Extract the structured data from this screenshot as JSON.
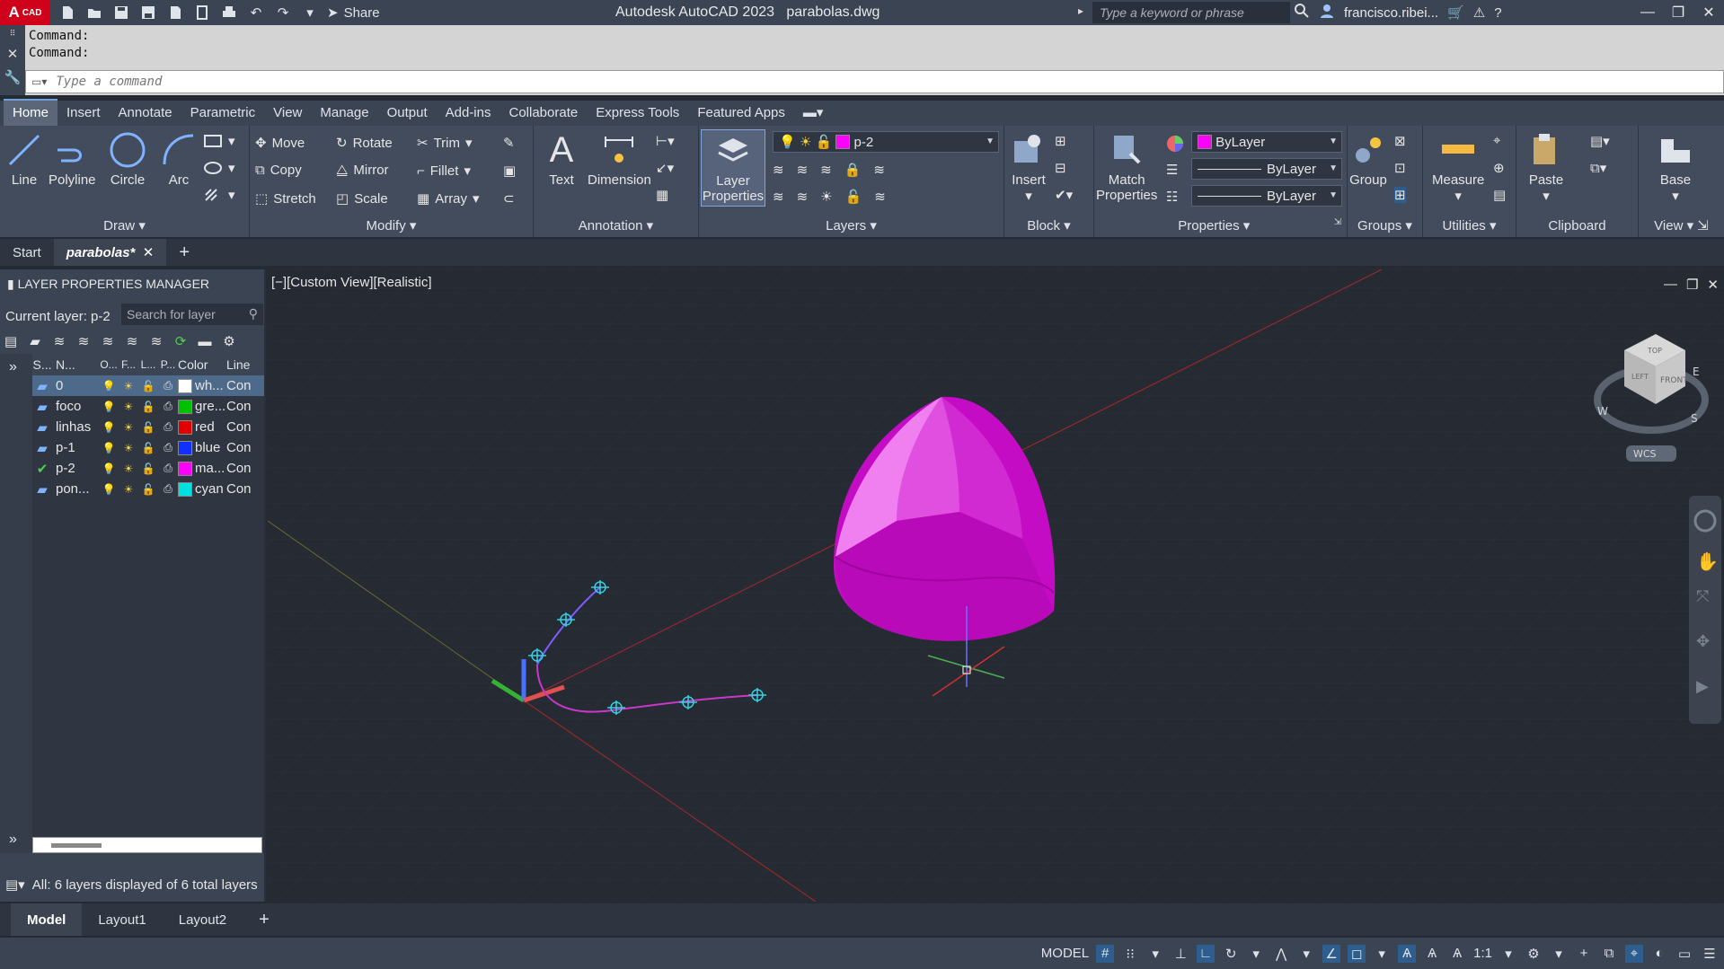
{
  "titlebar": {
    "logo": "A",
    "logo_sub": "CAD",
    "share": "Share",
    "title": "Autodesk AutoCAD 2023",
    "file": "parabolas.dwg",
    "search_placeholder": "Type a keyword or phrase",
    "user": "francisco.ribei..."
  },
  "command": {
    "history": [
      "Command:",
      "Command:"
    ],
    "placeholder": "Type a command"
  },
  "ribbon_tabs": [
    "Home",
    "Insert",
    "Annotate",
    "Parametric",
    "View",
    "Manage",
    "Output",
    "Add-ins",
    "Collaborate",
    "Express Tools",
    "Featured Apps"
  ],
  "active_ribbon_tab": "Home",
  "draw": {
    "title": "Draw",
    "line": "Line",
    "polyline": "Polyline",
    "circle": "Circle",
    "arc": "Arc"
  },
  "modify": {
    "title": "Modify",
    "move": "Move",
    "rotate": "Rotate",
    "trim": "Trim",
    "copy": "Copy",
    "mirror": "Mirror",
    "fillet": "Fillet",
    "stretch": "Stretch",
    "scale": "Scale",
    "array": "Array"
  },
  "annotation": {
    "title": "Annotation",
    "text": "Text",
    "dimension": "Dimension"
  },
  "layers": {
    "title": "Layers",
    "layer_properties_1": "Layer",
    "layer_properties_2": "Properties",
    "current_layer": "p-2"
  },
  "block": {
    "title": "Block",
    "insert": "Insert"
  },
  "properties": {
    "title": "Properties",
    "match_1": "Match",
    "match_2": "Properties",
    "color": "ByLayer",
    "lineweight": "ByLayer",
    "linetype": "ByLayer"
  },
  "groups": {
    "title": "Groups",
    "group": "Group"
  },
  "utilities": {
    "title": "Utilities",
    "measure": "Measure"
  },
  "clipboard": {
    "title": "Clipboard",
    "paste": "Paste"
  },
  "view_panel": {
    "title": "View",
    "base": "Base"
  },
  "doc_tabs": {
    "start": "Start",
    "active": "parabolas*"
  },
  "layer_manager": {
    "title": "LAYER PROPERTIES MANAGER",
    "current_layer_label": "Current layer: p-2",
    "search_placeholder": "Search for layer",
    "headers": [
      "S...",
      "N...",
      "O...",
      "F...",
      "L...",
      "P...",
      "Color",
      "Line"
    ],
    "rows": [
      {
        "name": "0",
        "color_name": "wh...",
        "color": "#ffffff",
        "line": "Con",
        "current": false,
        "selected": true
      },
      {
        "name": "foco",
        "color_name": "gre...",
        "color": "#00c000",
        "line": "Con",
        "current": false,
        "selected": false
      },
      {
        "name": "linhas",
        "color_name": "red",
        "color": "#e00000",
        "line": "Con",
        "current": false,
        "selected": false
      },
      {
        "name": "p-1",
        "color_name": "blue",
        "color": "#1030ff",
        "line": "Con",
        "current": false,
        "selected": false
      },
      {
        "name": "p-2",
        "color_name": "ma...",
        "color": "#ff00ff",
        "line": "Con",
        "current": true,
        "selected": false
      },
      {
        "name": "pon...",
        "color_name": "cyan",
        "color": "#00e0e0",
        "line": "Con",
        "current": false,
        "selected": false
      }
    ],
    "status": "All: 6 layers displayed of 6 total layers"
  },
  "viewport": {
    "label": "[−][Custom View][Realistic]",
    "viewcube_top": "TOP",
    "viewcube_front": "FRONT",
    "viewcube_left": "LEFT",
    "compass_e": "E",
    "compass_s": "S",
    "compass_w": "W",
    "wcs": "WCS"
  },
  "layout_tabs": [
    "Model",
    "Layout1",
    "Layout2"
  ],
  "statusbar": {
    "model": "MODEL",
    "scale": "1:1"
  },
  "colors": {
    "accent": "#6fa0d8",
    "shape": "#e010e0",
    "background": "#252a33"
  }
}
